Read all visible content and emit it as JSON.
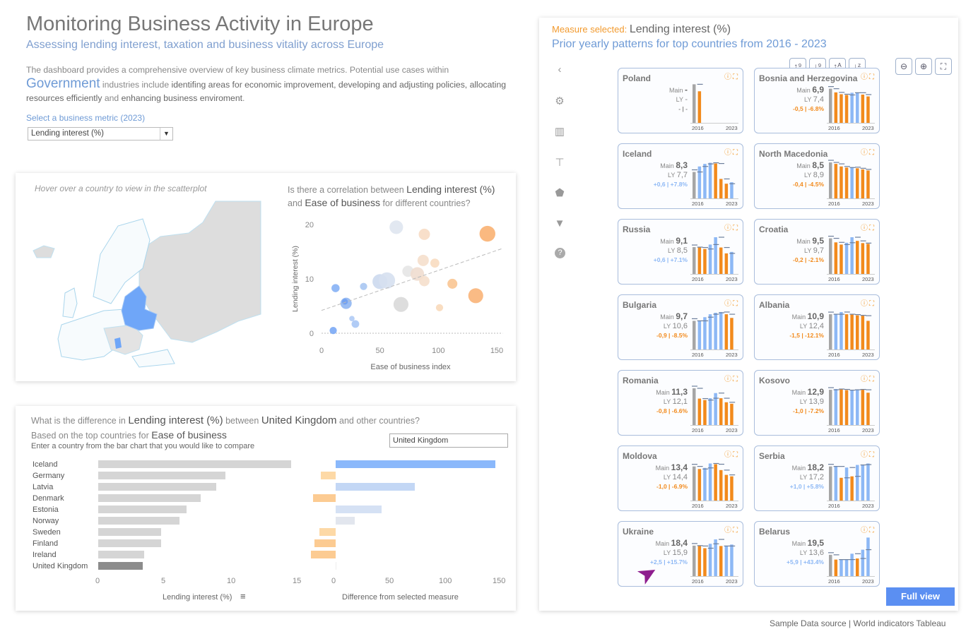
{
  "header": {
    "title": "Monitoring Business Activity in Europe",
    "subtitle": "Assessing lending interest, taxation and business vitality across Europe",
    "intro_1": "The dashboard provides a comprehensive overview of key business climate metrics. Potential use cases within ",
    "industry": "Government",
    "intro_2": " industries include ",
    "intro_3": "identifing areas for economic improvement, developing and adjusting policies, allocating resources efficiently",
    "intro_4": " and ",
    "intro_5": "enhancing business enviroment",
    "intro_6": "."
  },
  "metric_selector": {
    "label": "Select a business metric (2023)",
    "value": "Lending interest (%)"
  },
  "map": {
    "hint": "Hover over a country to view in the scatterplot"
  },
  "scatter": {
    "q1": "Is there a correlation between ",
    "q_measure": "Lending interest (%)",
    "q2": " and ",
    "q_measure2": "Ease of business",
    "q3": " for different countries?"
  },
  "bars": {
    "q1": "What is the difference in ",
    "q_measure": "Lending interest (%)",
    "q2": " between ",
    "q_country": "United Kingdom",
    "q3": "  and other countries?",
    "sub1": "Based on the top countries for ",
    "sub_measure": "Ease of business",
    "sub2": "Enter a country from the bar chart that you would like to compare",
    "compare_input": "United Kingdom"
  },
  "right": {
    "measure_prefix": "Measure selected: ",
    "measure": "Lending interest (%)",
    "subtitle": "Prior yearly patterns for top countries from 2016 - 2023",
    "full_view": "Full view",
    "year_start": "2016",
    "year_end": "2023",
    "main_label": "Main",
    "ly_label": "LY"
  },
  "toolbar": [
    "sort-asc-numeric",
    "sort-desc-numeric",
    "sort-asc-alpha",
    "sort-desc-alpha"
  ],
  "zoom_tools": [
    "zoom-out",
    "zoom-in",
    "fullscreen"
  ],
  "sidebar_icons": [
    "chevron-left",
    "gear",
    "bar-chart",
    "paint-roller",
    "tag",
    "filter",
    "help"
  ],
  "footer": {
    "source": "Sample Data source | World indicators Tableau"
  },
  "colors": {
    "accent_orange": "#f28a1c",
    "accent_blue": "#8db8f5",
    "grey": "#a6a6a6",
    "title_blue": "#6f9bd6"
  },
  "cards": [
    {
      "name": "Poland",
      "main": "-",
      "ly": "-",
      "delta": "- | -",
      "trend": "none",
      "bars": [
        10.5,
        8.6
      ]
    },
    {
      "name": "Bosnia and Herzegovina",
      "main": "6,9",
      "ly": "7,4",
      "delta": "-0,5 | -6.8%",
      "trend": "down",
      "bars": [
        9.3,
        8.3,
        7.8,
        7.6,
        8.2,
        8.2,
        7.7,
        7.2
      ]
    },
    {
      "name": "Iceland",
      "main": "8,3",
      "ly": "7,7",
      "delta": "+0,6 | +7.8%",
      "trend": "up",
      "bars": [
        7.2,
        8.7,
        9.4,
        9.7,
        9.5,
        5.3,
        4.0,
        4.4
      ]
    },
    {
      "name": "North Macedonia",
      "main": "8,5",
      "ly": "8,9",
      "delta": "-0,4 | -4.5%",
      "trend": "down",
      "bars": [
        9.8,
        9.4,
        8.7,
        8.4,
        8.5,
        8.2,
        7.9,
        7.6
      ]
    },
    {
      "name": "Russia",
      "main": "9,1",
      "ly": "8,5",
      "delta": "+0,6 | +7.1%",
      "trend": "up",
      "bars": [
        7.3,
        7.2,
        6.8,
        8.0,
        10.0,
        7.2,
        5.6,
        6.0
      ]
    },
    {
      "name": "Croatia",
      "main": "9,5",
      "ly": "9,7",
      "delta": "-0,2 | -2.1%",
      "trend": "down",
      "bars": [
        9.7,
        8.6,
        8.0,
        8.5,
        10.0,
        9.0,
        8.4,
        8.2
      ]
    },
    {
      "name": "Bulgaria",
      "main": "9,7",
      "ly": "10,6",
      "delta": "-0,9 | -8.5%",
      "trend": "down",
      "bars": [
        7.8,
        7.8,
        8.8,
        9.6,
        10.0,
        10.2,
        9.6,
        8.6
      ]
    },
    {
      "name": "Albania",
      "main": "10,9",
      "ly": "12,4",
      "delta": "-1,5 | -12.1%",
      "trend": "down",
      "bars": [
        9.6,
        9.6,
        10.2,
        9.6,
        9.5,
        9.3,
        9.2,
        7.8
      ]
    },
    {
      "name": "Romania",
      "main": "11,3",
      "ly": "12,1",
      "delta": "-0,8 | -6.6%",
      "trend": "down",
      "bars": [
        10.0,
        7.2,
        6.8,
        7.3,
        8.7,
        7.3,
        6.2,
        5.8
      ]
    },
    {
      "name": "Kosovo",
      "main": "12,9",
      "ly": "13,9",
      "delta": "-1,0 | -7.2%",
      "trend": "down",
      "bars": [
        9.6,
        9.8,
        9.7,
        9.5,
        9.6,
        9.7,
        9.6,
        8.8
      ]
    },
    {
      "name": "Moldova",
      "main": "13,4",
      "ly": "14,4",
      "delta": "-1,0 | -6.9%",
      "trend": "down",
      "bars": [
        9.3,
        8.6,
        8.9,
        10.1,
        9.9,
        8.3,
        7.0,
        6.6
      ]
    },
    {
      "name": "Serbia",
      "main": "18,2",
      "ly": "17,2",
      "delta": "+1,0 | +5.8%",
      "trend": "up",
      "bars": [
        9.3,
        9.3,
        6.2,
        9.0,
        6.6,
        9.7,
        9.8,
        10.1
      ]
    },
    {
      "name": "Ukraine",
      "main": "18,4",
      "ly": "15,9",
      "delta": "+2,5 | +15.7%",
      "trend": "up",
      "bars": [
        8.3,
        8.2,
        7.6,
        8.8,
        10.0,
        8.2,
        8.2,
        8.6
      ]
    },
    {
      "name": "Belarus",
      "main": "19,5",
      "ly": "13,6",
      "delta": "+5,9 | +43.4%",
      "trend": "up",
      "bars": [
        5.8,
        4.5,
        4.5,
        4.5,
        6.1,
        4.8,
        7.2,
        10.5
      ]
    }
  ],
  "chart_data": [
    {
      "type": "scatter",
      "xlabel": "Ease of business index",
      "ylabel": "Lending interest (%)",
      "xlim": [
        0,
        155
      ],
      "ylim": [
        0,
        21
      ],
      "xticks": [
        0,
        50,
        100,
        150
      ],
      "yticks": [
        0,
        10,
        20
      ],
      "trendline": [
        [
          0,
          4.2
        ],
        [
          155,
          15.6
        ]
      ],
      "points": [
        {
          "x": 64,
          "y": 19.5,
          "size": 3,
          "color": "#dfe6f0"
        },
        {
          "x": 88,
          "y": 18.2,
          "size": 2.5,
          "color": "#f7dcc4"
        },
        {
          "x": 142,
          "y": 18.3,
          "size": 3.5,
          "color": "#f9b172"
        },
        {
          "x": 87,
          "y": 13.4,
          "size": 2.5,
          "color": "#f5dfcc"
        },
        {
          "x": 97,
          "y": 12.9,
          "size": 2,
          "color": "#f8dcc0"
        },
        {
          "x": 74,
          "y": 11.4,
          "size": 2.5,
          "color": "#e6e6e6"
        },
        {
          "x": 82,
          "y": 10.9,
          "size": 3,
          "color": "#f0ddcf"
        },
        {
          "x": 88,
          "y": 9.6,
          "size": 2.3,
          "color": "#f5dfcc"
        },
        {
          "x": 112,
          "y": 9.1,
          "size": 2.2,
          "color": "#f9c592"
        },
        {
          "x": 132,
          "y": 6.9,
          "size": 3.3,
          "color": "#f9b478"
        },
        {
          "x": 101,
          "y": 4.7,
          "size": 1.6,
          "color": "#f8d9ba"
        },
        {
          "x": 68,
          "y": 5.3,
          "size": 3.3,
          "color": "#d9d9d9"
        },
        {
          "x": 50,
          "y": 9.5,
          "size": 3.3,
          "color": "#ccd9ee"
        },
        {
          "x": 56,
          "y": 9.7,
          "size": 3.6,
          "color": "#d6e0ef"
        },
        {
          "x": 12,
          "y": 8.3,
          "size": 1.8,
          "color": "#86b1f5"
        },
        {
          "x": 36,
          "y": 8.6,
          "size": 1.6,
          "color": "#a8c6f2"
        },
        {
          "x": 21,
          "y": 5.5,
          "size": 2.5,
          "color": "#8fb6f2"
        },
        {
          "x": 20,
          "y": 5.8,
          "size": 1.3,
          "color": "#6f9ff2"
        },
        {
          "x": 26,
          "y": 2.7,
          "size": 1.2,
          "color": "#b0cbf5"
        },
        {
          "x": 29,
          "y": 1.7,
          "size": 1.7,
          "color": "#a9c6f5"
        },
        {
          "x": 10,
          "y": 0.5,
          "size": 1.6,
          "color": "#7aa8f5"
        }
      ]
    },
    {
      "type": "bar",
      "xlabel": "Lending interest (%)",
      "xlim": [
        0,
        15
      ],
      "xticks": [
        0,
        5,
        10,
        15
      ],
      "categories": [
        "Iceland",
        "Germany",
        "Latvia",
        "Denmark",
        "Estonia",
        "Norway",
        "Sweden",
        "Finland",
        "Ireland",
        "United Kingdom"
      ],
      "values": [
        14.7,
        9.7,
        9.0,
        7.8,
        6.7,
        6.2,
        4.8,
        4.8,
        3.5,
        3.4
      ],
      "highlight": "United Kingdom"
    },
    {
      "type": "bar",
      "xlabel": "Difference from selected measure",
      "xlim": [
        -25,
        150
      ],
      "xticks": [
        0,
        50,
        100,
        150
      ],
      "categories": [
        "Iceland",
        "Germany",
        "Latvia",
        "Denmark",
        "Estonia",
        "Norway",
        "Sweden",
        "Finland",
        "Ireland",
        "United Kingdom"
      ],
      "values": [
        149,
        -14,
        74,
        -21,
        43,
        18,
        -15,
        -20,
        -23,
        0
      ]
    }
  ]
}
